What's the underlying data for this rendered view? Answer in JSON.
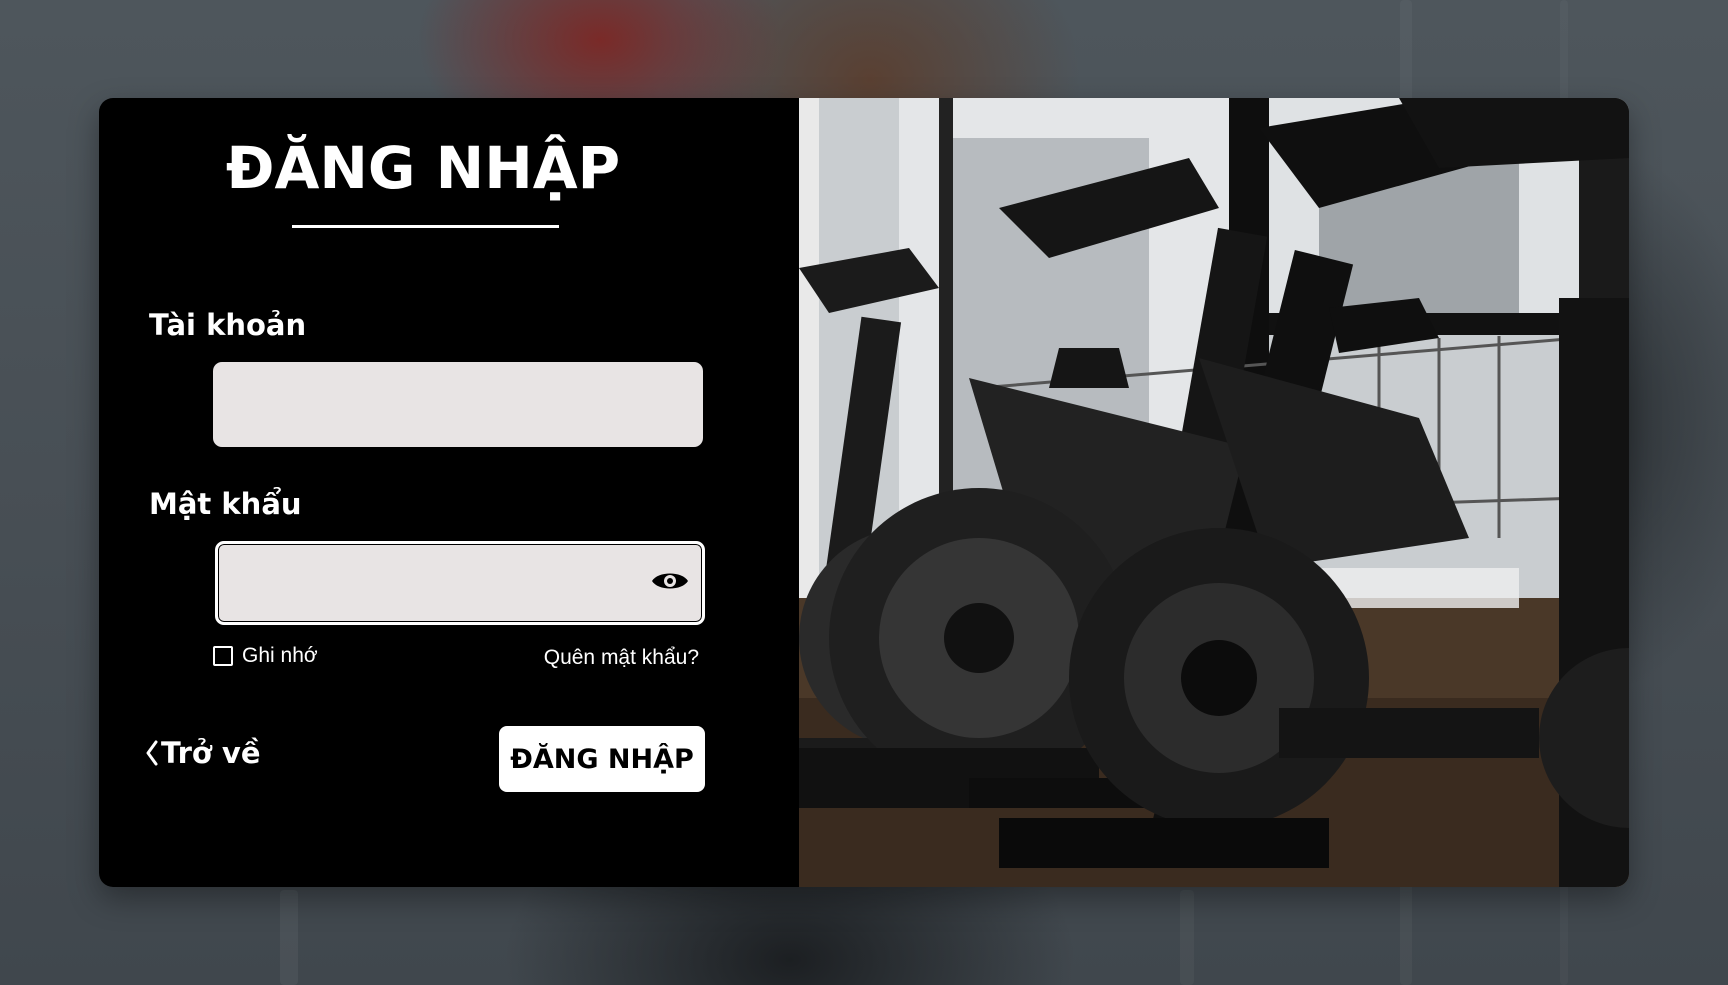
{
  "login": {
    "title": "ĐĂNG NHẬP",
    "username_label": "Tài khoản",
    "username_value": "",
    "password_label": "Mật khẩu",
    "password_value": "",
    "remember_label": "Ghi nhớ",
    "forgot_label": "Quên mật khẩu?",
    "back_label": "Trở về",
    "submit_label": "ĐĂNG NHẬP"
  },
  "icons": {
    "show_password": "eye-icon",
    "back": "chevron-left-icon"
  },
  "colors": {
    "panel_bg": "#000000",
    "input_bg": "#e8e4e4",
    "button_bg": "#ffffff",
    "page_bg": "#4a5157"
  }
}
